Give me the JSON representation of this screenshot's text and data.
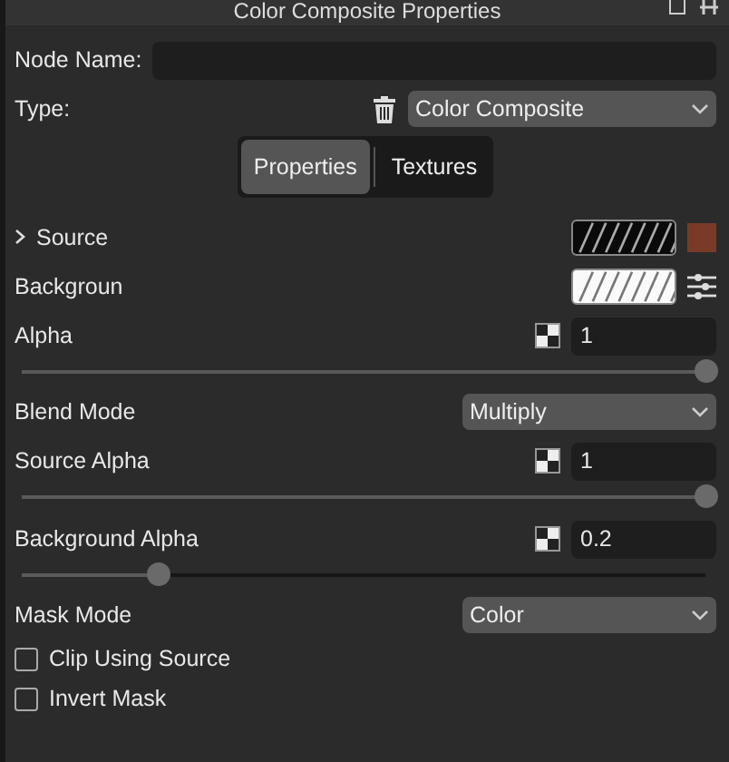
{
  "window": {
    "title": "Color Composite Properties"
  },
  "node_name": {
    "label": "Node Name:"
  },
  "type": {
    "label": "Type:",
    "value": "Color Composite"
  },
  "tabs": [
    {
      "label": "Properties",
      "selected": true
    },
    {
      "label": "Textures",
      "selected": false
    }
  ],
  "rows": [
    {
      "kind": "texture",
      "label": "Source",
      "expanded": false,
      "dark_swatch": true,
      "color": "#7a3a28"
    },
    {
      "kind": "texture",
      "label": "Backgroun",
      "dark_swatch": false
    },
    {
      "kind": "slider",
      "label": "Alpha",
      "value": "1",
      "level": 1
    },
    {
      "kind": "select",
      "label": "Blend Mode",
      "value": "Multiply"
    },
    {
      "kind": "slider",
      "label": "Source Alpha",
      "value": "1",
      "level": 1
    },
    {
      "kind": "slider",
      "label": "Background Alpha",
      "value": "0.2",
      "level": 0.2
    },
    {
      "kind": "select",
      "label": "Mask Mode",
      "value": "Color"
    },
    {
      "kind": "checkbox",
      "label": "Clip Using Source",
      "checked": false
    },
    {
      "kind": "checkbox",
      "label": "Invert Mask",
      "checked": false
    }
  ]
}
